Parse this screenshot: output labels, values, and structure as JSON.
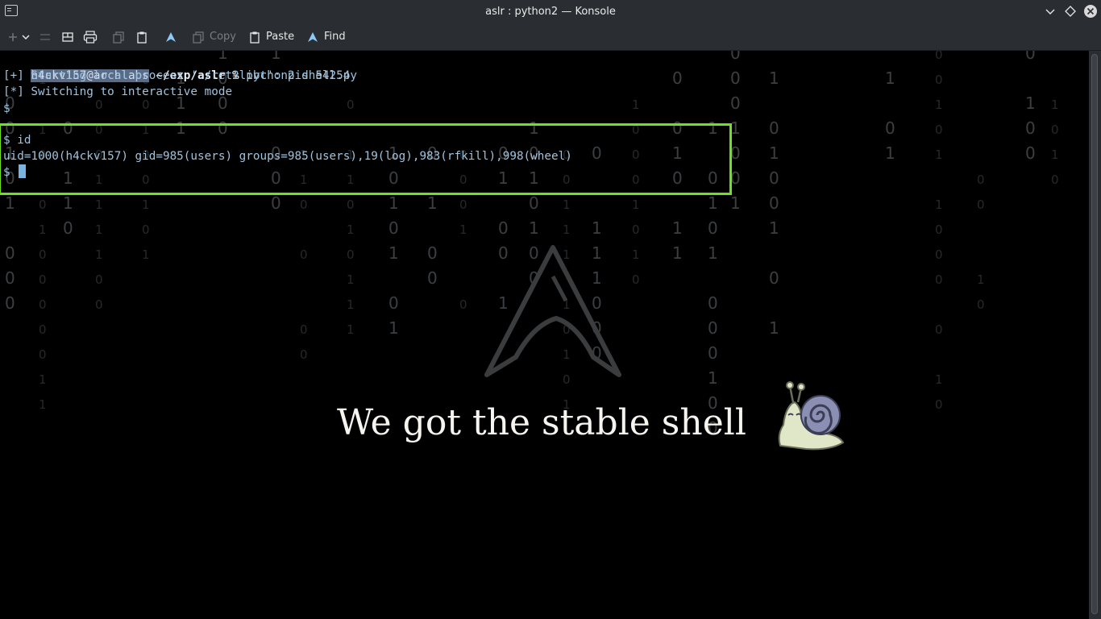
{
  "window": {
    "title": "aslr : python2 — Konsole"
  },
  "toolbar": {
    "new_tab_icon": "plus-icon",
    "copy_label": "Copy",
    "paste_label": "Paste",
    "find_label": "Find"
  },
  "terminal": {
    "prompt": {
      "user_host": "h4ckv157@archlabs",
      "path": " ~/exp/aslr",
      "symbol": " %",
      "command": " python2 shell.py"
    },
    "lines": [
      "[+] Starting local process './ret2libc': pid 54254",
      "[*] Switching to interactive mode",
      "$",
      "$ id",
      "uid=1000(h4ckv157) gid=985(users) groups=985(users),19(log),983(rfkill),998(wheel)",
      "$ "
    ],
    "caption": "We got the stable shell",
    "highlight_color": "#6fe21f",
    "background_image": "arch-linux-matrix-wallpaper"
  },
  "colors": {
    "titlebar": "#2a2e32",
    "terminal_text": "#9fc3dd",
    "cursor": "#79b5e0"
  }
}
